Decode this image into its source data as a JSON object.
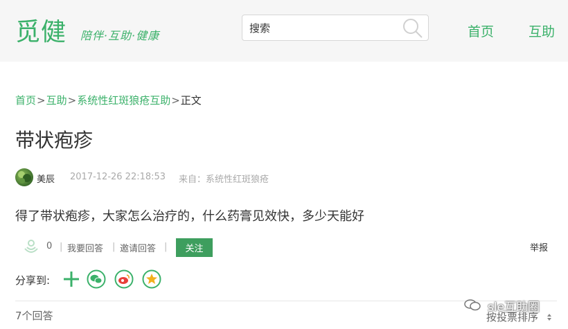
{
  "header": {
    "logo": "觅健",
    "slogan": "陪伴·互助·健康",
    "search_placeholder": "搜索",
    "nav": [
      "首页",
      "互助"
    ]
  },
  "breadcrumb": {
    "items": [
      "首页",
      "互助",
      "系统性红斑狼疮互助"
    ],
    "current": "正文",
    "separator": ">"
  },
  "question": {
    "title": "带状疱疹",
    "author": "美辰",
    "date": "2017-12-26 22:18:53",
    "source": "来自：系统性红斑狼疮",
    "body": "得了带状疱疹，大家怎么治疗的，什么药膏见效快，多少天能好"
  },
  "actions": {
    "like_count": "0",
    "my_answer": "我要回答",
    "invite": "邀请回答",
    "follow": "关注",
    "report": "举报"
  },
  "share": {
    "label": "分享到:",
    "icons": [
      "plus-icon",
      "wechat-icon",
      "weibo-icon",
      "qzone-icon"
    ]
  },
  "answers": {
    "count_label": "7个回答",
    "sort_label": "按投票排序"
  },
  "watermark": "sle互助圈",
  "colors": {
    "brand": "#3bb16a",
    "button": "#3e9e5e",
    "header_bg": "#f6f6f6"
  }
}
